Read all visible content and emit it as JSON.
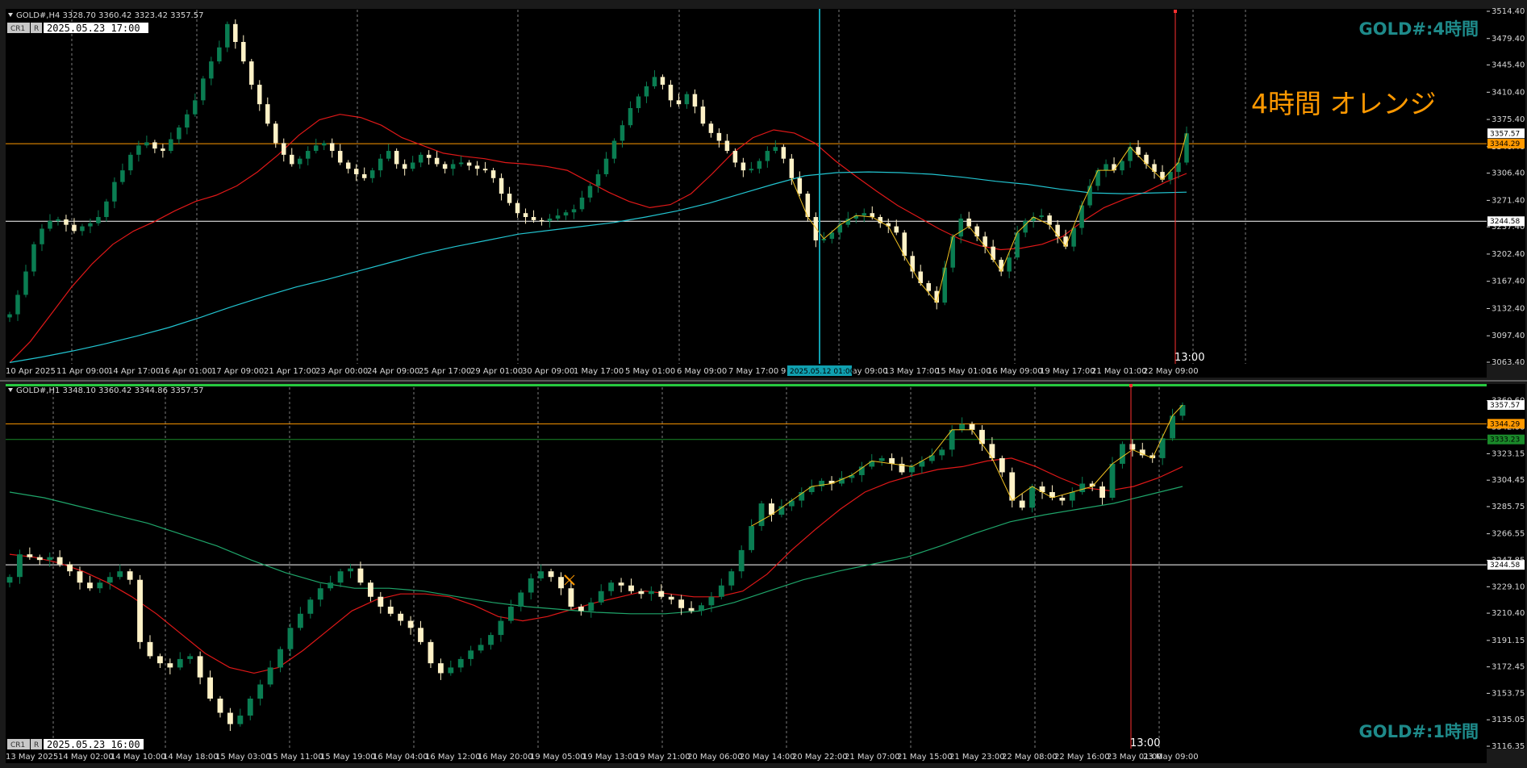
{
  "colors": {
    "background": "#000000",
    "frame": "#1a1a1a",
    "bull": "#0a7d52",
    "bear": "#fff2c7",
    "ma_red": "#e01818",
    "ma_cyan": "#22c4d0",
    "ma_green": "#1fa56a",
    "zigzag": "#f0c020",
    "orange_line": "#ff9900",
    "white_line": "#ffffff",
    "green_line": "#1a8a2a",
    "vline_red": "#ff3030",
    "vline_cyan": "#10a0b0",
    "watermark": "#1e8a8a",
    "grid": "#9a9a9a"
  },
  "panel_top": {
    "header": "GOLD#,H4  3328.70 3360.42 3323.42 3357.57",
    "button_1": "CR1",
    "button_2": "R",
    "stamp": "2025.05.23 17:00",
    "watermark": "GOLD#:4時間",
    "note": "4時間  オレンジ",
    "time_marker": "13:00",
    "crosshair_date": "2025.05.12 01:00",
    "price_tags": {
      "last": "3357.57",
      "orange": "3344.29",
      "white": "3244.58"
    },
    "price_ticks": [
      "3514.40",
      "3479.40",
      "3445.40",
      "3410.40",
      "3375.40",
      "3340.40",
      "3306.40",
      "3271.40",
      "3237.40",
      "3202.40",
      "3167.40",
      "3132.40",
      "3097.40",
      "3063.40"
    ],
    "time_ticks": [
      "10 Apr 2025",
      "11 Apr 09:00",
      "14 Apr 17:00",
      "16 Apr 01:00",
      "17 Apr 09:00",
      "21 Apr 17:00",
      "23 Apr 00:00",
      "24 Apr 09:00",
      "25 Apr 17:00",
      "29 Apr 01:00",
      "30 Apr 09:00",
      "1 May 17:00",
      "5 May 01:00",
      "6 May 09:00",
      "7 May 17:00",
      "9 May 01:00",
      "12 May 09:00",
      "13 May 17:00",
      "15 May 01:00",
      "16 May 09:00",
      "19 May 17:00",
      "21 May 01:00",
      "22 May 09:00"
    ]
  },
  "panel_bottom": {
    "header": "GOLD#,H1  3348.10 3360.42 3344.86 3357.57",
    "button_1": "CR1",
    "button_2": "R",
    "stamp": "2025.05.23 16:00",
    "watermark": "GOLD#:1時間",
    "time_marker": "13:00",
    "price_tags": {
      "last": "3357.57",
      "orange": "3344.29",
      "green": "3333.23",
      "white": "3244.58"
    },
    "price_ticks": [
      "3360.60",
      "3342.00",
      "3323.15",
      "3304.45",
      "3285.75",
      "3266.55",
      "3247.85",
      "3229.10",
      "3210.40",
      "3191.15",
      "3172.45",
      "3153.75",
      "3135.05",
      "3116.35"
    ],
    "time_ticks": [
      "13 May 2025",
      "14 May 02:00",
      "14 May 10:00",
      "14 May 18:00",
      "15 May 03:00",
      "15 May 11:00",
      "15 May 19:00",
      "16 May 04:00",
      "16 May 12:00",
      "16 May 20:00",
      "19 May 05:00",
      "19 May 13:00",
      "19 May 21:00",
      "20 May 06:00",
      "20 May 14:00",
      "20 May 22:00",
      "21 May 07:00",
      "21 May 15:00",
      "21 May 23:00",
      "22 May 08:00",
      "22 May 16:00",
      "23 May 01:00",
      "23 May 09:00"
    ]
  },
  "chart_data": [
    {
      "type": "candlestick",
      "symbol": "GOLD#",
      "timeframe": "H4",
      "ylim": [
        3063.4,
        3514.4
      ],
      "grid": true,
      "hlines": {
        "orange": 3344.29,
        "white": 3244.58
      },
      "ohlc_last": {
        "open": 3328.7,
        "high": 3360.42,
        "low": 3323.42,
        "close": 3357.57
      },
      "close_path": [
        3125,
        3150,
        3180,
        3215,
        3235,
        3245,
        3247,
        3240,
        3232,
        3238,
        3242,
        3250,
        3270,
        3295,
        3310,
        3330,
        3342,
        3346,
        3338,
        3335,
        3350,
        3365,
        3382,
        3400,
        3428,
        3450,
        3468,
        3498,
        3475,
        3450,
        3420,
        3395,
        3370,
        3345,
        3330,
        3318,
        3325,
        3335,
        3342,
        3345,
        3335,
        3320,
        3312,
        3305,
        3300,
        3310,
        3325,
        3335,
        3318,
        3312,
        3320,
        3330,
        3326,
        3318,
        3312,
        3318,
        3320,
        3316,
        3312,
        3310,
        3300,
        3280,
        3268,
        3255,
        3250,
        3246,
        3245,
        3248,
        3252,
        3256,
        3260,
        3275,
        3290,
        3305,
        3325,
        3348,
        3368,
        3390,
        3405,
        3418,
        3430,
        3420,
        3400,
        3395,
        3408,
        3392,
        3370,
        3358,
        3348,
        3335,
        3320,
        3310,
        3312,
        3322,
        3335,
        3340,
        3325,
        3300,
        3280,
        3250,
        3220,
        3222,
        3230,
        3240,
        3248,
        3252,
        3255,
        3250,
        3242,
        3238,
        3230,
        3200,
        3180,
        3165,
        3155,
        3140,
        3185,
        3225,
        3248,
        3238,
        3225,
        3212,
        3195,
        3180,
        3198,
        3230,
        3245,
        3250,
        3252,
        3240,
        3225,
        3212,
        3236,
        3265,
        3290,
        3310,
        3318,
        3310,
        3322,
        3340,
        3330,
        3318,
        3308,
        3298,
        3308,
        3320,
        3357.57
      ],
      "ma_red": [
        3063,
        3090,
        3125,
        3160,
        3190,
        3215,
        3232,
        3244,
        3258,
        3270,
        3278,
        3290,
        3308,
        3330,
        3355,
        3375,
        3382,
        3378,
        3368,
        3352,
        3342,
        3332,
        3328,
        3325,
        3320,
        3318,
        3315,
        3310,
        3296,
        3282,
        3270,
        3262,
        3266,
        3280,
        3305,
        3332,
        3352,
        3362,
        3358,
        3345,
        3322,
        3302,
        3283,
        3265,
        3250,
        3235,
        3222,
        3213,
        3208,
        3210,
        3215,
        3225,
        3245,
        3262,
        3273,
        3282,
        3295,
        3306
      ],
      "ma_cyan": [
        3063,
        3070,
        3078,
        3087,
        3097,
        3108,
        3121,
        3135,
        3148,
        3160,
        3170,
        3181,
        3192,
        3203,
        3212,
        3220,
        3228,
        3233,
        3238,
        3243,
        3250,
        3258,
        3268,
        3280,
        3292,
        3303,
        3307,
        3308,
        3307,
        3305,
        3301,
        3296,
        3292,
        3286,
        3281,
        3280,
        3281,
        3282
      ]
    },
    {
      "type": "candlestick",
      "symbol": "GOLD#",
      "timeframe": "H1",
      "ylim": [
        3116.35,
        3369.0
      ],
      "grid": true,
      "hlines": {
        "orange": 3344.29,
        "green": 3333.23,
        "white": 3244.58
      },
      "ohlc_last": {
        "open": 3348.1,
        "high": 3360.42,
        "low": 3344.86,
        "close": 3357.57
      },
      "close_path": [
        3236,
        3252,
        3250,
        3248,
        3250,
        3245,
        3240,
        3232,
        3228,
        3232,
        3236,
        3240,
        3234,
        3190,
        3180,
        3175,
        3172,
        3178,
        3180,
        3165,
        3150,
        3140,
        3132,
        3138,
        3150,
        3160,
        3172,
        3185,
        3200,
        3210,
        3220,
        3228,
        3232,
        3240,
        3242,
        3232,
        3222,
        3215,
        3210,
        3205,
        3200,
        3190,
        3175,
        3168,
        3172,
        3178,
        3184,
        3188,
        3195,
        3205,
        3215,
        3225,
        3235,
        3240,
        3236,
        3228,
        3215,
        3212,
        3218,
        3226,
        3232,
        3230,
        3226,
        3224,
        3226,
        3222,
        3220,
        3214,
        3212,
        3216,
        3222,
        3230,
        3240,
        3255,
        3272,
        3288,
        3280,
        3286,
        3290,
        3296,
        3300,
        3304,
        3302,
        3306,
        3308,
        3314,
        3318,
        3320,
        3316,
        3310,
        3314,
        3318,
        3322,
        3326,
        3340,
        3344,
        3340,
        3330,
        3320,
        3310,
        3290,
        3285,
        3300,
        3296,
        3292,
        3290,
        3296,
        3302,
        3300,
        3292,
        3316,
        3330,
        3326,
        3322,
        3320,
        3334,
        3350,
        3357.57
      ],
      "ma_red": [
        3252,
        3250,
        3246,
        3240,
        3232,
        3222,
        3210,
        3196,
        3182,
        3172,
        3168,
        3172,
        3184,
        3198,
        3212,
        3220,
        3224,
        3224,
        3222,
        3216,
        3208,
        3205,
        3208,
        3213,
        3218,
        3222,
        3226,
        3224,
        3222,
        3222,
        3226,
        3238,
        3255,
        3270,
        3284,
        3296,
        3303,
        3308,
        3312,
        3314,
        3318,
        3320,
        3314,
        3306,
        3299,
        3297,
        3300,
        3306,
        3314
      ],
      "ma_green": [
        3296,
        3292,
        3286,
        3280,
        3274,
        3266,
        3258,
        3248,
        3239,
        3232,
        3228,
        3228,
        3226,
        3222,
        3218,
        3215,
        3213,
        3211,
        3210,
        3210,
        3212,
        3218,
        3226,
        3234,
        3240,
        3245,
        3250,
        3258,
        3267,
        3275,
        3280,
        3284,
        3288,
        3294,
        3300
      ]
    }
  ]
}
